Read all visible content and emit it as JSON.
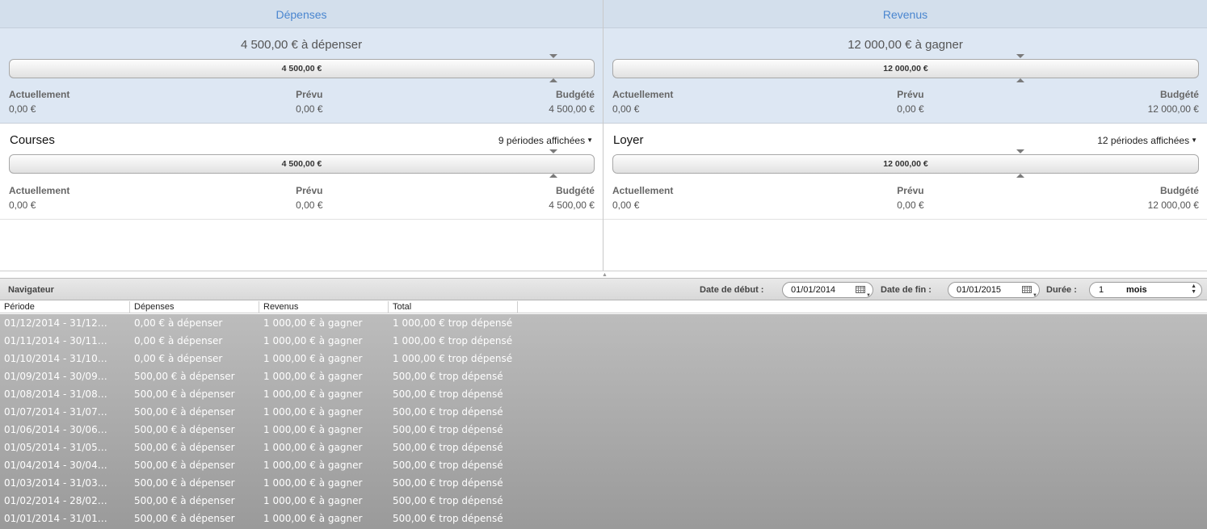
{
  "depenses": {
    "header": "Dépenses",
    "summary_title": "4 500,00 € à dépenser",
    "bar_value": "4 500,00 €",
    "stats": {
      "actuellement_label": "Actuellement",
      "actuellement_value": "0,00 €",
      "prevu_label": "Prévu",
      "prevu_value": "0,00 €",
      "budgete_label": "Budgété",
      "budgete_value": "4 500,00 €"
    },
    "category": {
      "name": "Courses",
      "periods": "9 périodes affichées",
      "bar_value": "4 500,00 €",
      "actuellement_label": "Actuellement",
      "actuellement_value": "0,00 €",
      "prevu_label": "Prévu",
      "prevu_value": "0,00 €",
      "budgete_label": "Budgété",
      "budgete_value": "4 500,00 €"
    }
  },
  "revenus": {
    "header": "Revenus",
    "summary_title": "12 000,00 € à gagner",
    "bar_value": "12 000,00 €",
    "stats": {
      "actuellement_label": "Actuellement",
      "actuellement_value": "0,00 €",
      "prevu_label": "Prévu",
      "prevu_value": "0,00 €",
      "budgete_label": "Budgété",
      "budgete_value": "12 000,00 €"
    },
    "category": {
      "name": "Loyer",
      "periods": "12 périodes affichées",
      "bar_value": "12 000,00 €",
      "actuellement_label": "Actuellement",
      "actuellement_value": "0,00 €",
      "prevu_label": "Prévu",
      "prevu_value": "0,00 €",
      "budgete_label": "Budgété",
      "budgete_value": "12 000,00 €"
    }
  },
  "navigator": {
    "title": "Navigateur",
    "start_label": "Date de début :",
    "start_value": "01/01/2014",
    "end_label": "Date de fin :",
    "end_value": "01/01/2015",
    "duration_label": "Durée :",
    "duration_value": "1",
    "duration_unit": "mois"
  },
  "table": {
    "columns": [
      "Période",
      "Dépenses",
      "Revenus",
      "Total"
    ],
    "rows": [
      [
        "01/12/2014 - 31/12…",
        "0,00 € à dépenser",
        "1 000,00 € à gagner",
        "1 000,00 € trop dépensé"
      ],
      [
        "01/11/2014 - 30/11…",
        "0,00 € à dépenser",
        "1 000,00 € à gagner",
        "1 000,00 € trop dépensé"
      ],
      [
        "01/10/2014 - 31/10…",
        "0,00 € à dépenser",
        "1 000,00 € à gagner",
        "1 000,00 € trop dépensé"
      ],
      [
        "01/09/2014 - 30/09…",
        "500,00 € à dépenser",
        "1 000,00 € à gagner",
        "500,00 € trop dépensé"
      ],
      [
        "01/08/2014 - 31/08…",
        "500,00 € à dépenser",
        "1 000,00 € à gagner",
        "500,00 € trop dépensé"
      ],
      [
        "01/07/2014 - 31/07…",
        "500,00 € à dépenser",
        "1 000,00 € à gagner",
        "500,00 € trop dépensé"
      ],
      [
        "01/06/2014 - 30/06…",
        "500,00 € à dépenser",
        "1 000,00 € à gagner",
        "500,00 € trop dépensé"
      ],
      [
        "01/05/2014 - 31/05…",
        "500,00 € à dépenser",
        "1 000,00 € à gagner",
        "500,00 € trop dépensé"
      ],
      [
        "01/04/2014 - 30/04…",
        "500,00 € à dépenser",
        "1 000,00 € à gagner",
        "500,00 € trop dépensé"
      ],
      [
        "01/03/2014 - 31/03…",
        "500,00 € à dépenser",
        "1 000,00 € à gagner",
        "500,00 € trop dépensé"
      ],
      [
        "01/02/2014 - 28/02…",
        "500,00 € à dépenser",
        "1 000,00 € à gagner",
        "500,00 € trop dépensé"
      ],
      [
        "01/01/2014 - 31/01…",
        "500,00 € à dépenser",
        "1 000,00 € à gagner",
        "500,00 € trop dépensé"
      ]
    ]
  },
  "colors": {
    "header_text": "#4a86cf",
    "header_bg": "#d3dfec",
    "summary_bg": "#dde7f3",
    "table_bg_top": "#bcbcbc",
    "table_bg_bottom": "#9a9a9a"
  }
}
